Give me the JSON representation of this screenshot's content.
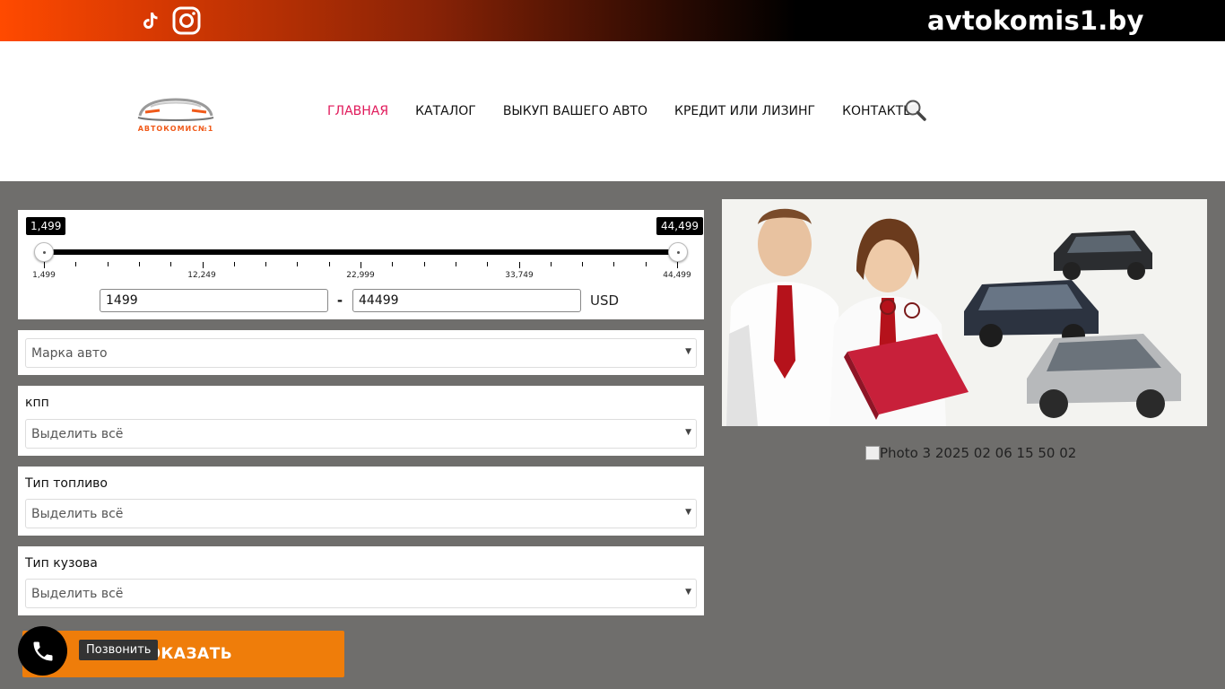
{
  "topbar": {
    "domain": "avtokomis1.by",
    "icons": [
      "tiktok-icon",
      "instagram-icon"
    ],
    "gradient_colors": [
      "#ff4a00",
      "#000000"
    ]
  },
  "header": {
    "logo_text": "АВТОКОМИС№1",
    "nav": [
      {
        "label": "ГЛАВНАЯ",
        "active": true
      },
      {
        "label": "КАТАЛОГ",
        "active": false
      },
      {
        "label": "ВЫКУП ВАШЕГО АВТО",
        "active": false
      },
      {
        "label": "КРЕДИТ ИЛИ ЛИЗИНГ",
        "active": false
      },
      {
        "label": "КОНТАКТЫ",
        "active": false
      }
    ],
    "active_color": "#e0195a"
  },
  "filters": {
    "price": {
      "min_label": "1,499",
      "max_label": "44,499",
      "ticks": [
        "1,499",
        "12,249",
        "22,999",
        "33,749",
        "44,499"
      ],
      "min_value": "1499",
      "max_value": "44499",
      "separator": "-",
      "currency": "USD"
    },
    "brand": {
      "placeholder": "Марка авто"
    },
    "transmission": {
      "label": "кпп",
      "value": "Выделить всё"
    },
    "fuel": {
      "label": "Тип топливо",
      "value": "Выделить всё"
    },
    "body": {
      "label": "Тип кузова",
      "value": "Выделить всё"
    },
    "submit_label": "ПОКАЗАТЬ",
    "submit_color": "#ef7d0a"
  },
  "call_widget": {
    "tooltip": "Позвонить"
  },
  "banner": {
    "broken_image_alt": "Photo 3 2025 02 06 15 50 02"
  }
}
